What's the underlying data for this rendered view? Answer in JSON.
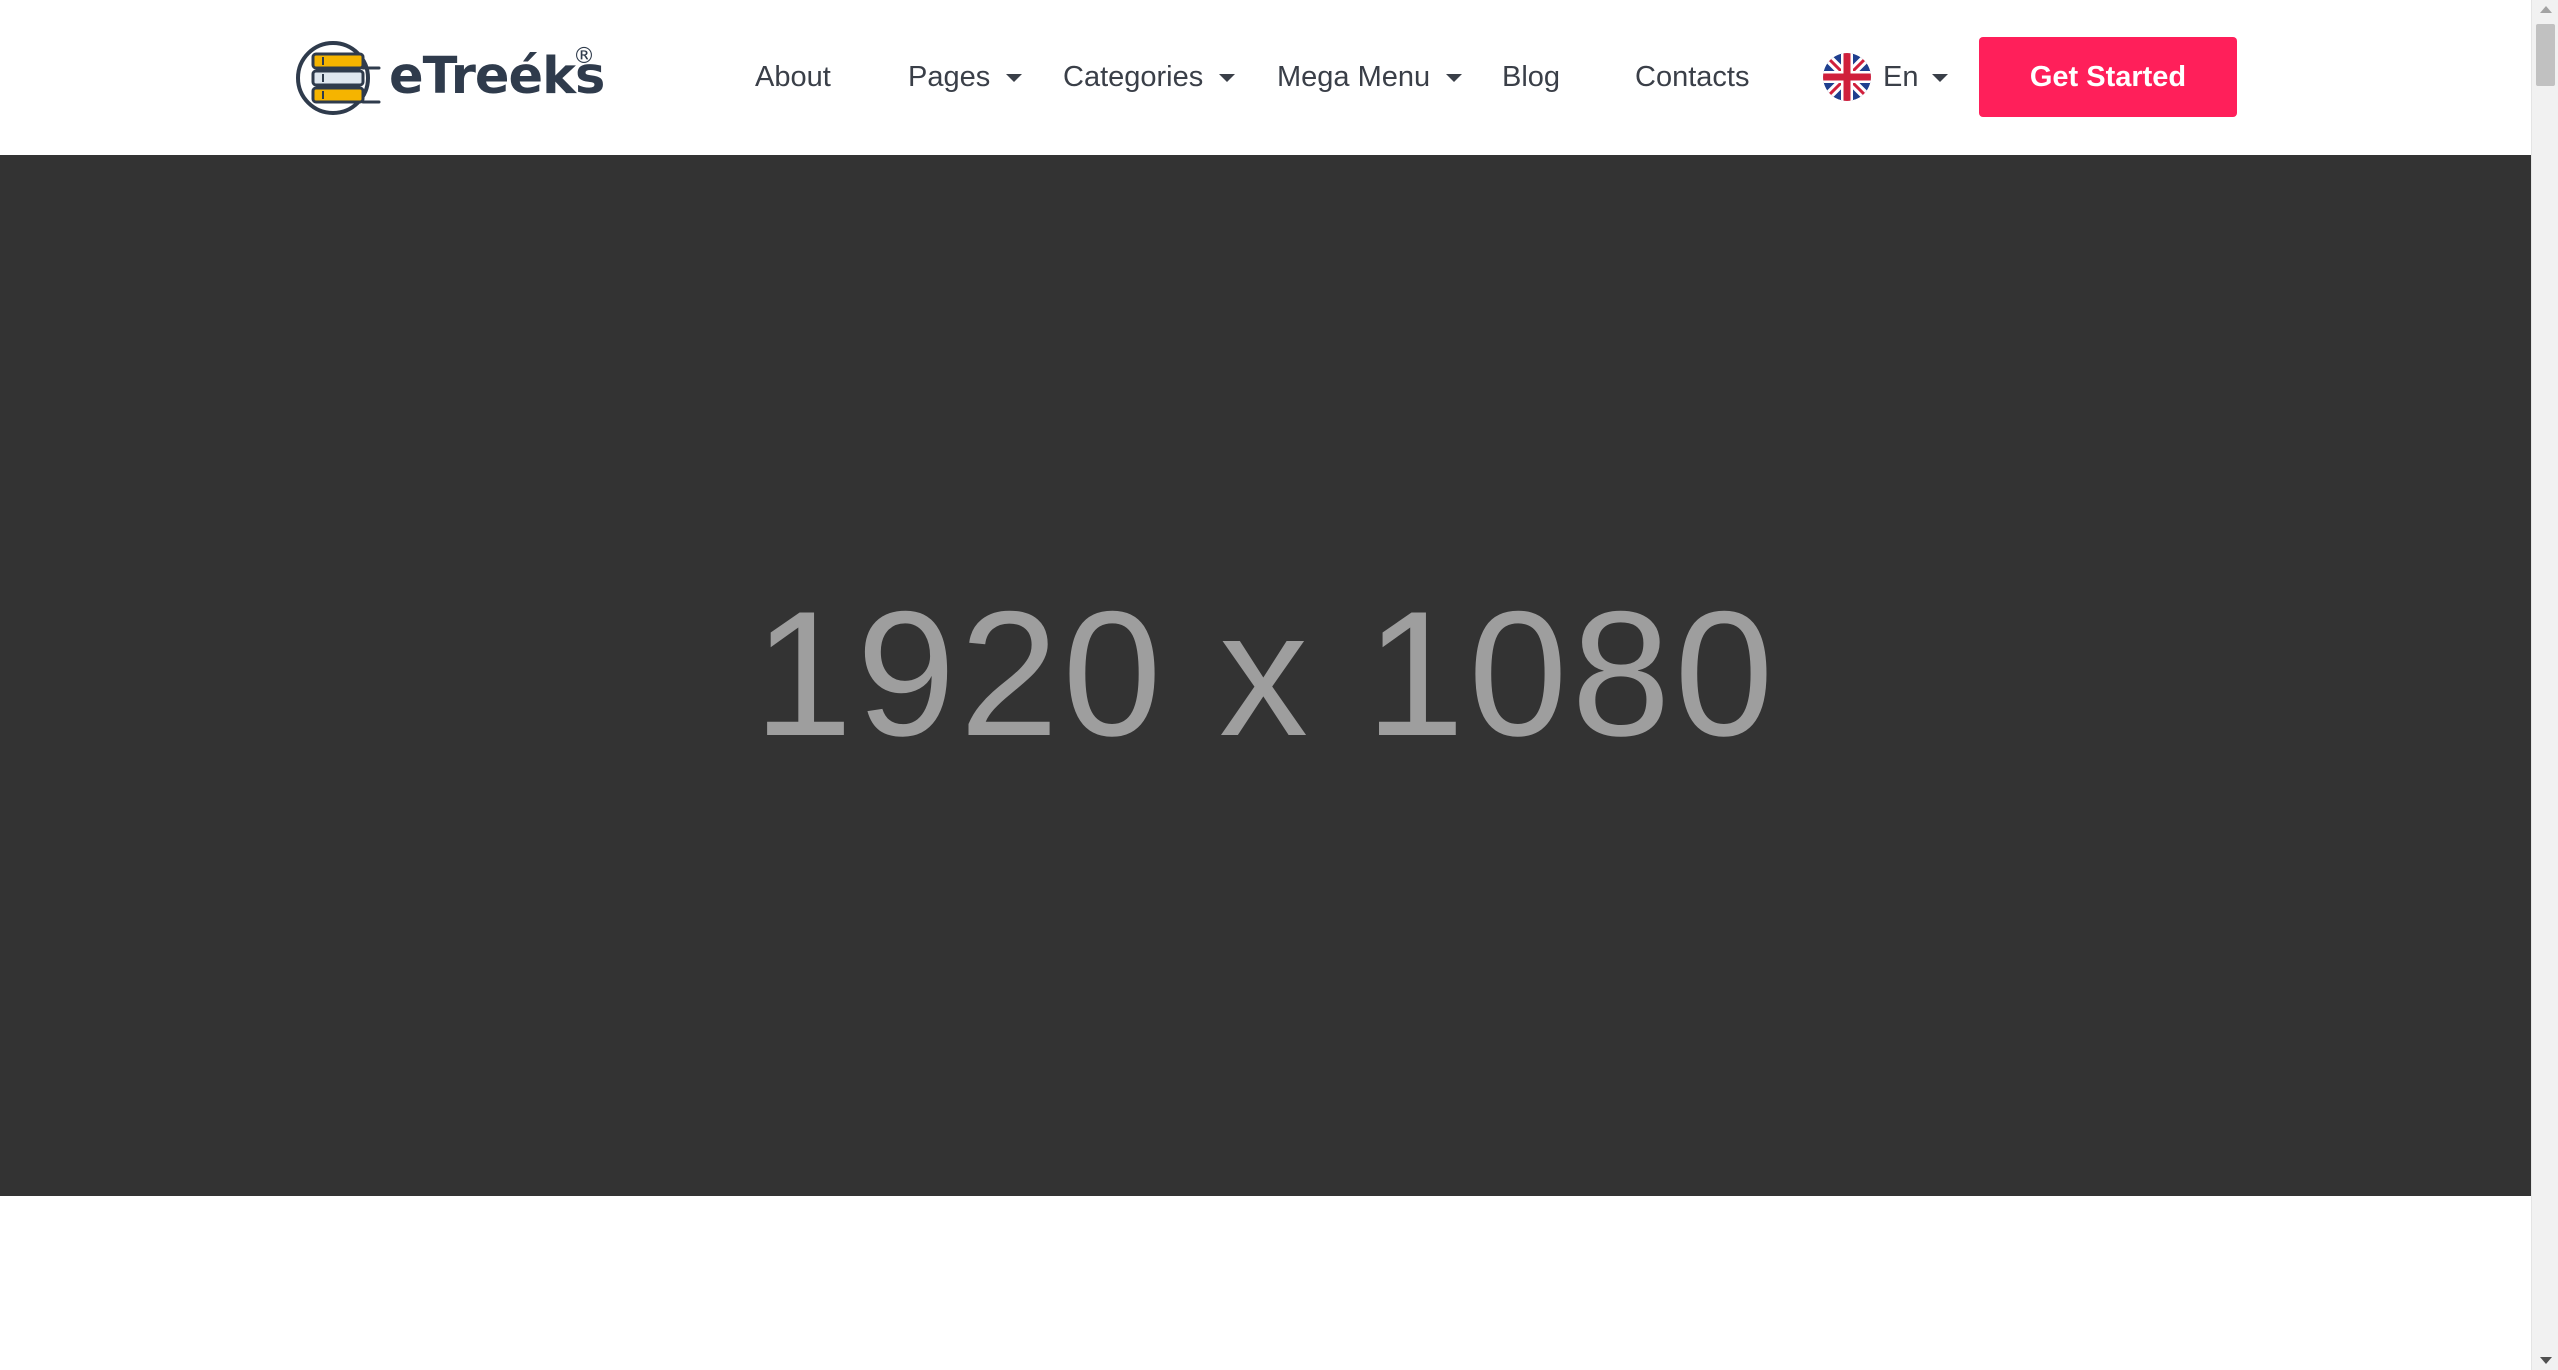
{
  "header": {
    "brand": {
      "name": "eTreéks",
      "registered_mark": "®",
      "icon": "books-logo-icon"
    },
    "nav": [
      {
        "label": "About",
        "has_dropdown": false
      },
      {
        "label": "Pages",
        "has_dropdown": true
      },
      {
        "label": "Categories",
        "has_dropdown": true
      },
      {
        "label": "Mega Menu",
        "has_dropdown": true
      },
      {
        "label": "Blog",
        "has_dropdown": false
      },
      {
        "label": "Contacts",
        "has_dropdown": false
      }
    ],
    "language": {
      "label": "En",
      "flag_icon": "uk-flag-icon"
    },
    "cta_label": "Get Started"
  },
  "hero": {
    "placeholder_text": "1920 x 1080"
  },
  "colors": {
    "accent": "#ff1f5a",
    "hero_bg": "#333333",
    "hero_text": "#9e9e9e",
    "nav_text": "#3a3f48",
    "brand_text": "#2f3b4c",
    "logo_book_yellow": "#f5b400"
  }
}
